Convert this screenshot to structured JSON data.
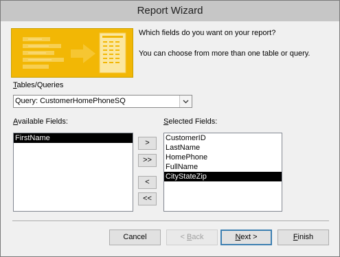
{
  "window": {
    "title": "Report Wizard"
  },
  "intro": {
    "question": "Which fields do you want on your report?",
    "hint": "You can choose from more than one table or query."
  },
  "tables": {
    "label_mnemonic": "T",
    "label_rest": "ables/Queries",
    "selected": "Query: CustomerHomePhoneSQ"
  },
  "available": {
    "label_mnemonic": "A",
    "label_rest": "vailable Fields:",
    "items": [
      "FirstName"
    ],
    "selected_index": 0
  },
  "selected_fields": {
    "label_pre": "",
    "label_mnemonic": "S",
    "label_rest": "elected Fields:",
    "items": [
      "CustomerID",
      "LastName",
      "HomePhone",
      "FullName",
      "CityStateZip"
    ],
    "selected_index": 4
  },
  "move_buttons": {
    "add_one": ">",
    "add_all": ">>",
    "remove_one": "<",
    "remove_all": "<<"
  },
  "footer": {
    "cancel": "Cancel",
    "back_mnemonic": "B",
    "back_pre": "< ",
    "back_rest": "ack",
    "next_mnemonic": "N",
    "next_rest": "ext >",
    "finish_mnemonic": "F",
    "finish_rest": "inish"
  }
}
